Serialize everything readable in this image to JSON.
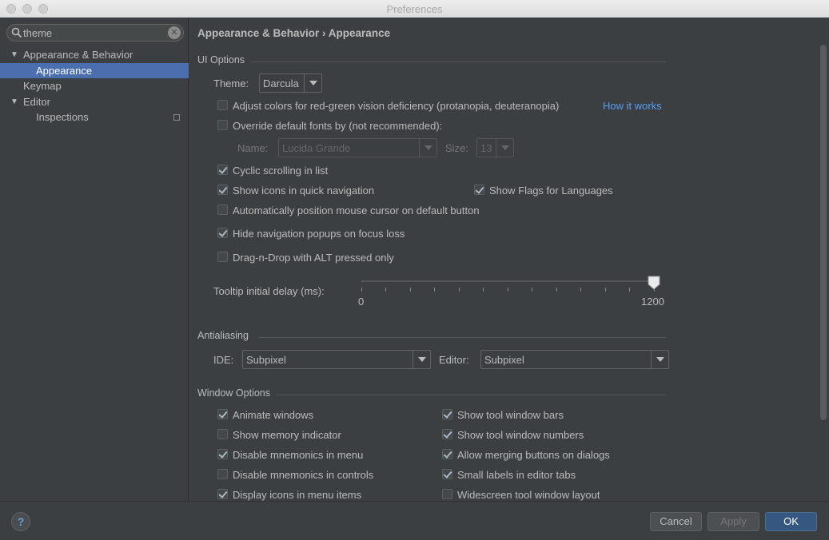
{
  "window": {
    "title": "Preferences"
  },
  "search": {
    "value": "theme",
    "placeholder": ""
  },
  "tree": [
    {
      "label": "Appearance & Behavior",
      "expanded": true,
      "selected": false
    },
    {
      "label": "Appearance",
      "selected": true
    },
    {
      "label": "Keymap",
      "selected": false
    },
    {
      "label": "Editor",
      "expanded": true,
      "selected": false
    },
    {
      "label": "Inspections",
      "selected": false
    }
  ],
  "breadcrumb": "Appearance & Behavior › Appearance",
  "ui_options": {
    "section_title": "UI Options",
    "theme_label": "Theme:",
    "theme_value": "Darcula",
    "adjust_colors": {
      "label": "Adjust colors for red-green vision deficiency (protanopia, deuteranopia)",
      "checked": false
    },
    "how_it_works": "How it works",
    "override_fonts": {
      "label": "Override default fonts by (not recommended):",
      "checked": false
    },
    "name_label": "Name:",
    "name_value": "Lucida Grande",
    "size_label": "Size:",
    "size_value": "13",
    "cyclic_scrolling": {
      "label": "Cyclic scrolling in list",
      "checked": true
    },
    "show_icons_quick_nav": {
      "label": "Show icons in quick navigation",
      "checked": true
    },
    "show_flags": {
      "label": "Show Flags for Languages",
      "checked": true
    },
    "auto_position_mouse": {
      "label": "Automatically position mouse cursor on default button",
      "checked": false
    },
    "hide_nav_popups": {
      "label": "Hide navigation popups on focus loss",
      "checked": true
    },
    "drag_n_drop": {
      "label": "Drag-n-Drop with ALT pressed only",
      "checked": false
    },
    "tooltip_label": "Tooltip initial delay (ms):",
    "tooltip_min": "0",
    "tooltip_max": "1200",
    "tooltip_value": 1200
  },
  "antialiasing": {
    "section_title": "Antialiasing",
    "ide_label": "IDE:",
    "ide_value": "Subpixel",
    "editor_label": "Editor:",
    "editor_value": "Subpixel"
  },
  "window_options": {
    "section_title": "Window Options",
    "left": [
      {
        "label": "Animate windows",
        "checked": true
      },
      {
        "label": "Show memory indicator",
        "checked": false
      },
      {
        "label": "Disable mnemonics in menu",
        "checked": true
      },
      {
        "label": "Disable mnemonics in controls",
        "checked": false
      },
      {
        "label": "Display icons in menu items",
        "checked": true
      }
    ],
    "right": [
      {
        "label": "Show tool window bars",
        "checked": true
      },
      {
        "label": "Show tool window numbers",
        "checked": true
      },
      {
        "label": "Allow merging buttons on dialogs",
        "checked": true
      },
      {
        "label": "Small labels in editor tabs",
        "checked": true
      },
      {
        "label": "Widescreen tool window layout",
        "checked": false
      }
    ]
  },
  "buttons": {
    "help": "?",
    "cancel": "Cancel",
    "apply": "Apply",
    "ok": "OK"
  },
  "colors": {
    "background": "#3c3f41",
    "selection": "#4b6eaf",
    "link": "#589df6",
    "default_button": "#365880"
  }
}
